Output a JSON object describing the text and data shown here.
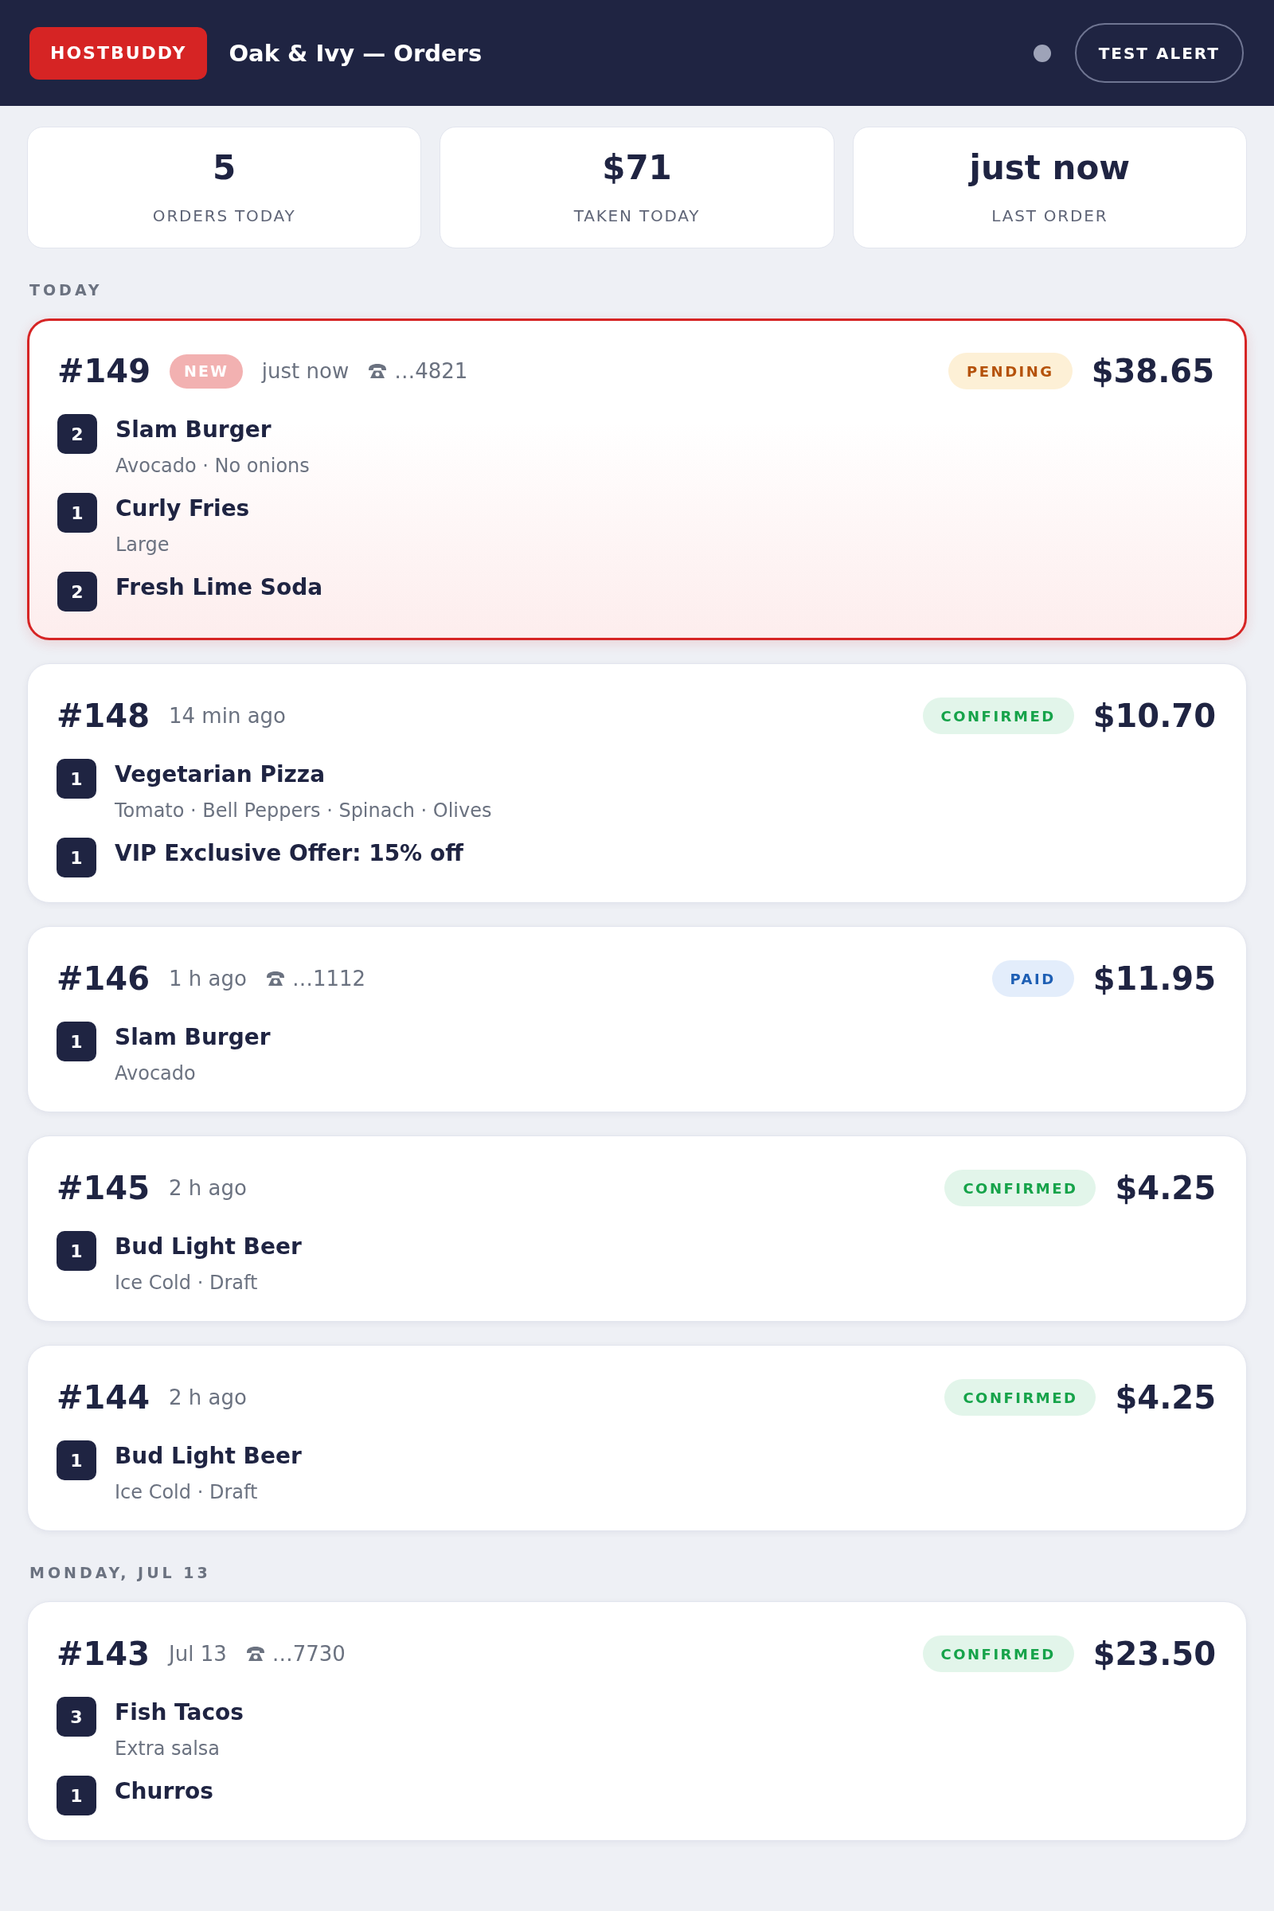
{
  "header": {
    "logo": "HOSTBUDDY",
    "title": "Oak & Ivy — Orders",
    "live": false,
    "button": "TEST ALERT"
  },
  "stats": [
    {
      "value": "5",
      "label": "ORDERS TODAY"
    },
    {
      "value": "$71",
      "label": "TAKEN TODAY"
    },
    {
      "value": "just now",
      "label": "LAST ORDER"
    }
  ],
  "sections": [
    {
      "title": "TODAY",
      "orders": [
        {
          "number": "#149",
          "highlighted": true,
          "badge": "NEW",
          "time": "just now",
          "phone": "…4821",
          "status": {
            "label": "PENDING",
            "kind": "pending"
          },
          "total": "$38.65",
          "items": [
            {
              "qty": "2",
              "name": "Slam Burger",
              "modifiers": "Avocado · No onions"
            },
            {
              "qty": "1",
              "name": "Curly Fries",
              "modifiers": "Large"
            },
            {
              "qty": "2",
              "name": "Fresh Lime Soda"
            }
          ]
        },
        {
          "number": "#148",
          "highlighted": false,
          "time": "14 min ago",
          "status": {
            "label": "CONFIRMED",
            "kind": "confirmed"
          },
          "total": "$10.70",
          "items": [
            {
              "qty": "1",
              "name": "Vegetarian Pizza",
              "modifiers": "Tomato · Bell Peppers · Spinach · Olives"
            },
            {
              "qty": "1",
              "name": "VIP Exclusive Offer: 15% off"
            }
          ]
        },
        {
          "number": "#146",
          "highlighted": false,
          "time": "1 h ago",
          "phone": "…1112",
          "status": {
            "label": "PAID",
            "kind": "paid"
          },
          "total": "$11.95",
          "items": [
            {
              "qty": "1",
              "name": "Slam Burger",
              "modifiers": "Avocado"
            }
          ]
        },
        {
          "number": "#145",
          "highlighted": false,
          "time": "2 h ago",
          "status": {
            "label": "CONFIRMED",
            "kind": "confirmed"
          },
          "total": "$4.25",
          "items": [
            {
              "qty": "1",
              "name": "Bud Light Beer",
              "modifiers": "Ice Cold · Draft"
            }
          ]
        },
        {
          "number": "#144",
          "highlighted": false,
          "time": "2 h ago",
          "status": {
            "label": "CONFIRMED",
            "kind": "confirmed"
          },
          "total": "$4.25",
          "items": [
            {
              "qty": "1",
              "name": "Bud Light Beer",
              "modifiers": "Ice Cold · Draft"
            }
          ]
        }
      ]
    },
    {
      "title": "MONDAY, JUL 13",
      "orders": [
        {
          "number": "#143",
          "highlighted": false,
          "time": "Jul 13",
          "phone": "…7730",
          "status": {
            "label": "CONFIRMED",
            "kind": "confirmed"
          },
          "total": "$23.50",
          "items": [
            {
              "qty": "3",
              "name": "Fish Tacos",
              "modifiers": "Extra salsa"
            },
            {
              "qty": "1",
              "name": "Churros"
            }
          ]
        }
      ]
    }
  ]
}
